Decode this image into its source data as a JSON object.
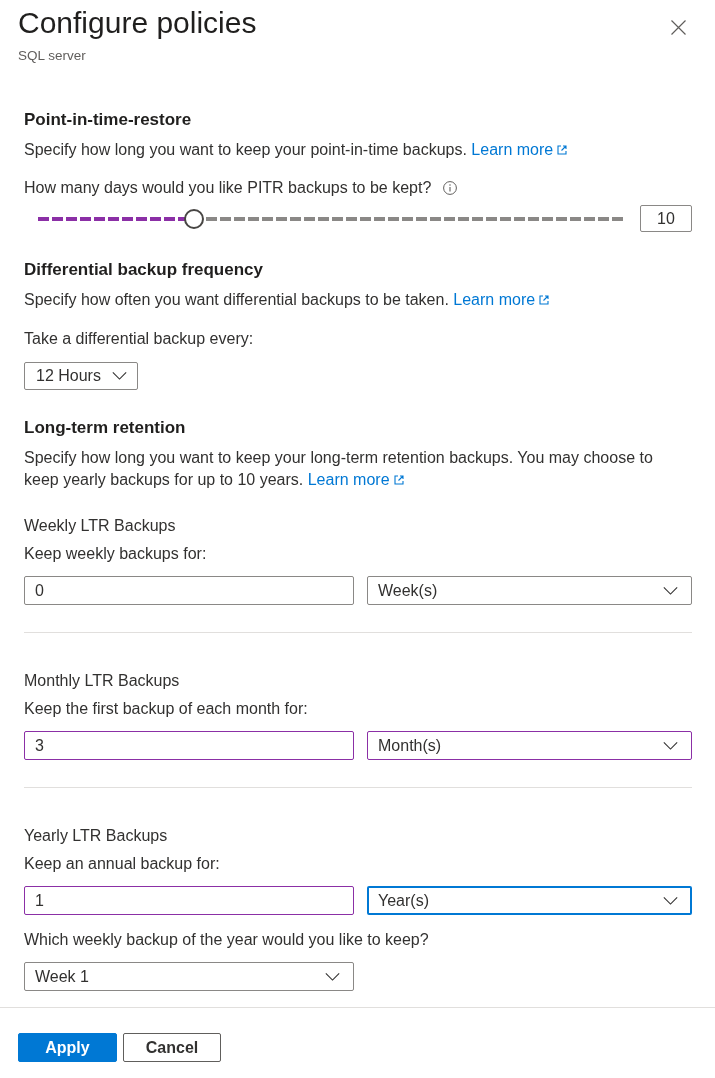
{
  "header": {
    "title": "Configure policies",
    "subtitle": "SQL server"
  },
  "sections": [
    {
      "heading": "Point-in-time-restore",
      "description": "Specify how long you want to keep your point-in-time backups.",
      "link": "Learn more",
      "items": [
        {
          "kind": "slider",
          "label": "How many days would you like PITR backups to be kept?",
          "level": 0.265,
          "modified": true,
          "value": "10"
        }
      ]
    },
    {
      "heading": "Differential backup frequency",
      "description": "Specify how often you want differential backups to be taken.",
      "link": "Learn more",
      "items": [
        {
          "kind": "dropdown",
          "label": "Take a differential backup every:",
          "value": "12 Hours",
          "modified": false
        }
      ]
    },
    {
      "heading": "Long-term retention",
      "description": "Specify how long you want to keep your long-term retention backups. You may choose to keep yearly backups for up to 10 years.",
      "link": "Learn more",
      "items": [
        {
          "kind": "retention",
          "title": "Weekly LTR Backups",
          "label": "Keep weekly backups for:",
          "amount": {
            "value": "0",
            "modified": false
          },
          "unit": {
            "value": "Week(s)",
            "modified": false,
            "focused": false
          }
        },
        {
          "kind": "retention",
          "title": "Monthly LTR Backups",
          "label": "Keep the first backup of each month for:",
          "amount": {
            "value": "3",
            "modified": true
          },
          "unit": {
            "value": "Month(s)",
            "modified": true,
            "focused": false
          }
        },
        {
          "kind": "retention",
          "title": "Yearly LTR Backups",
          "label": "Keep an annual backup for:",
          "amount": {
            "value": "1",
            "modified": true
          },
          "unit": {
            "value": "Year(s)",
            "modified": false,
            "focused": true
          },
          "question": {
            "label": "Which weekly backup of the year would you like to keep?",
            "value": "Week 1",
            "modified": false
          }
        }
      ]
    }
  ],
  "buttons": [
    {
      "label": "Apply",
      "kind": "primary"
    },
    {
      "label": "Cancel",
      "kind": "secondary"
    }
  ]
}
